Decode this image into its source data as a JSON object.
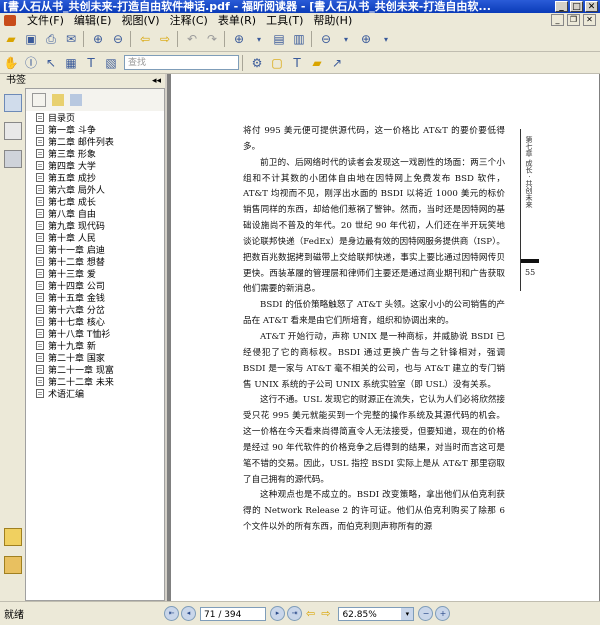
{
  "window": {
    "title": "[書人石从书_共创未来-打造自由软件神话.pdf - 福昕阅读器 - [書人石从书_共创未来-打造自由软..."
  },
  "menu": [
    "文件(F)",
    "编辑(E)",
    "视图(V)",
    "注释(C)",
    "表单(R)",
    "工具(T)",
    "帮助(H)"
  ],
  "toolbar": {
    "search_placeholder": "查找"
  },
  "sidebar": {
    "title": "书签",
    "collapse_label": "◂◂",
    "bookmarks": [
      "目录页",
      "第一章 斗争",
      "第二章 邮件列表",
      "第三章 形象",
      "第四章 大学",
      "第五章 成抄",
      "第六章 局外人",
      "第七章 成长",
      "第八章 自由",
      "第九章 现代码",
      "第十章 人民",
      "第十一章 启迪",
      "第十二章 想替",
      "第十三章 爱",
      "第十四章 公司",
      "第十五章 金钱",
      "第十六章 分岔",
      "第十七章 核心",
      "第十八章 T恤衫",
      "第十九章 新",
      "第二十章 国家",
      "第二十一章 现富",
      "第二十二章 未来",
      "术语汇编"
    ]
  },
  "document": {
    "paragraphs": [
      {
        "indent": false,
        "text": "将付 995 美元便可提供源代码，这一价格比 AT&T 的要价要低得多。"
      },
      {
        "indent": true,
        "text": "前卫的、后网络时代的读者会发现这一戏剧性的场面：两三个小组和不计其数的小团体自由地在因特网上免费发布 BSD 软件，AT&T 均视而不见，刚浮出水面的 BSDI 以将近 1000 美元的标价销售同样的东西，却给他们惹祸了警钟。然而，当时还是因特网的基础设施尚不普及的年代。20 世纪 90 年代初，人们还在半开玩笑地谈论联邦快递（FedEx）是身边最有效的因特网服务提供商（ISP）。把数百兆数据拷到磁带上交给联邦快递，事实上要比通过因特网传贝更快。西装革履的管理层和律师们主要还是通过商业期刊和广告获取他们需要的新消息。"
      },
      {
        "indent": true,
        "text": "BSDI 的低价策略触怒了 AT&T 头领。这家小小的公司销售的产品在 AT&T 看来是由它们所培育，组织和协调出来的。"
      },
      {
        "indent": true,
        "text": "AT&T 开始行动，声称 UNIX 是一种商标，并威胁说 BSDI 已经侵犯了它的商标权。BSDI 通过更换广告与之针锋相对，强调 BSDI 是一家与 AT&T 毫不相关的公司，也与 AT&T 建立的专门销售 UNIX 系统的子公司 UNIX 系统实验室（即 USL）没有关系。"
      },
      {
        "indent": true,
        "text": "这行不通。USL 发现它的财源正在流失，它认为人们必将欣然接受只花 995 美元就能买到一个完整的操作系统及其源代码的机会。这一价格在今天看来尚得简直令人无法接受，但要知道，现在的价格是经过 90 年代软件的价格竞争之后得到的结果，对当时而言这可是笔不错的交易。因此，USL 指控 BSDI 实际上是从 AT&T 那里窃取了自己拥有的源代码。"
      },
      {
        "indent": true,
        "text": "这种观点也是不成立的。BSDI 改变策略，拿出他们从伯克利获得的 Network Release 2 的许可证。他们从伯克利购买了除那 6 个文件以外的所有东西，而伯克利则声称所有的源"
      }
    ],
    "side_chapter": "第七章 成长 · 共创未来",
    "page_number": "55"
  },
  "status": {
    "text": "就绪",
    "page_field": "71 / 394",
    "zoom": "62.85%"
  }
}
